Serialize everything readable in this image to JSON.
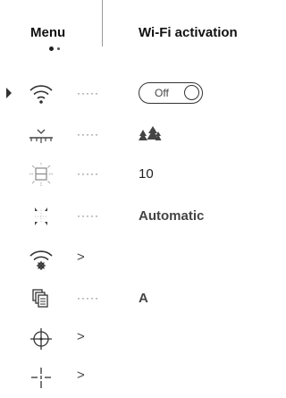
{
  "header": {
    "menu_label": "Menu",
    "title": "Wi-Fi activation"
  },
  "menu_items": [
    {
      "icon": "wifi-icon",
      "value": "Off",
      "control": "toggle",
      "selected": true
    },
    {
      "icon": "terrain-icon",
      "value": "forest-icon",
      "control": "leader"
    },
    {
      "icon": "illuminator-icon",
      "value": "10",
      "control": "leader"
    },
    {
      "icon": "display-mode-icon",
      "value": "Automatic",
      "control": "leader"
    },
    {
      "icon": "wifi-settings-icon",
      "value": "",
      "control": "submenu"
    },
    {
      "icon": "copy-icon",
      "value": "A",
      "control": "leader"
    },
    {
      "icon": "crosshair-icon",
      "value": "",
      "control": "submenu"
    },
    {
      "icon": "reticle-icon",
      "value": "",
      "control": "submenu"
    }
  ],
  "leader_text": "·····",
  "submenu_arrow": ">"
}
